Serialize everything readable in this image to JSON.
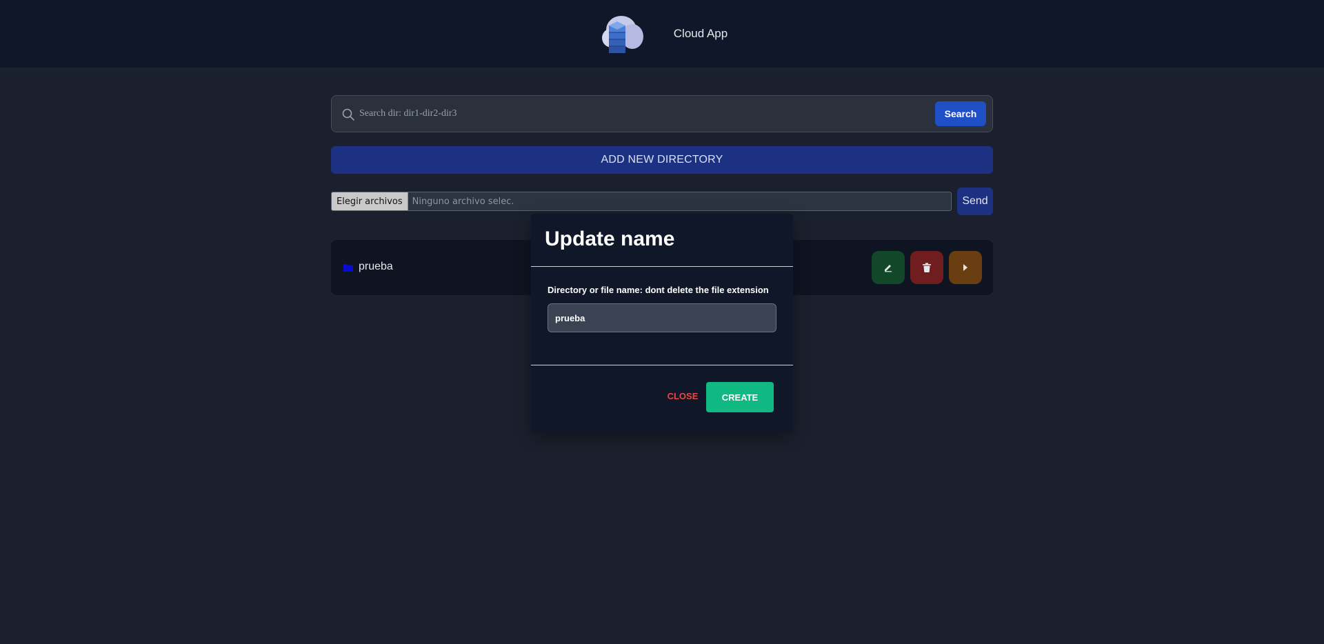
{
  "header": {
    "app_title": "Cloud App",
    "logo_icon": "cloud-server-logo"
  },
  "search": {
    "placeholder": "Search dir: dir1-dir2-dir3",
    "value": "",
    "button_label": "Search",
    "icon": "search-icon"
  },
  "add_directory": {
    "label": "ADD NEW DIRECTORY"
  },
  "upload": {
    "choose_label": "Elegir archivos",
    "status_text": "Ninguno archivo selec.",
    "send_label": "Send"
  },
  "directories": [
    {
      "name": "prueba",
      "icon": "folder-icon",
      "actions": [
        "edit-icon",
        "trash-icon",
        "play-icon"
      ]
    }
  ],
  "modal": {
    "title": "Update name",
    "label": "Directory or file name: dont delete the file extension",
    "input_value": "prueba",
    "close_label": "CLOSE",
    "create_label": "CREATE"
  },
  "colors": {
    "background": "#1a202d",
    "topbar": "#0f1729",
    "primary": "#1f4fc4",
    "add_button": "#1d3183",
    "edit": "#13472a",
    "delete": "#6f1d1f",
    "open": "#6b3e12",
    "create": "#10b981",
    "close": "#f04444"
  }
}
